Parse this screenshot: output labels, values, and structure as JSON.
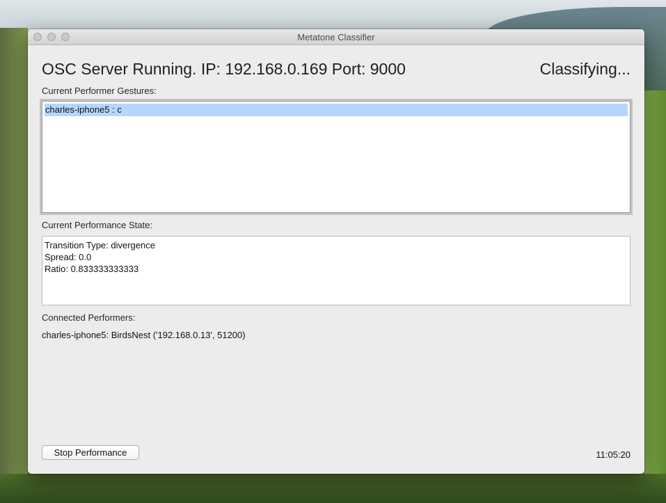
{
  "window": {
    "title": "Metatone Classifier"
  },
  "header": {
    "server_status": "OSC Server Running. IP: 192.168.0.169 Port: 9000",
    "classifier_status": "Classifying..."
  },
  "gestures": {
    "label": "Current Performer Gestures:",
    "items": [
      "charles-iphone5 : c"
    ],
    "selected_index": 0,
    "selection_color": "#b6d6fb"
  },
  "state": {
    "label": "Current Performance State:",
    "lines": [
      "Transition Type: divergence",
      "Spread: 0.0",
      "Ratio: 0.833333333333"
    ]
  },
  "connected": {
    "label": "Connected Performers:",
    "text": "charles-iphone5: BirdsNest ('192.168.0.13', 51200)"
  },
  "footer": {
    "stop_button": "Stop Performance",
    "clock": "11:05:20"
  }
}
